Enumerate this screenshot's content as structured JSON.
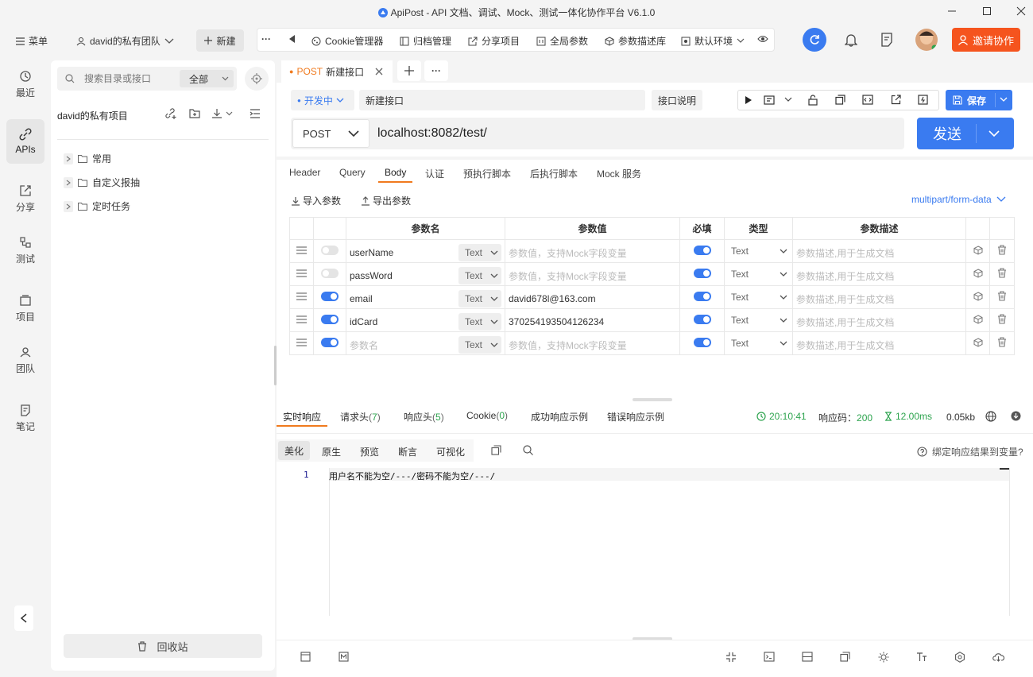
{
  "window": {
    "title": "ApiPost - API 文档、调试、Mock、测试一体化协作平台 V6.1.0"
  },
  "topbar": {
    "menu_label": "菜单",
    "team_label": "david的私有团队",
    "new_label": "新建",
    "cookie_label": "Cookie管理器",
    "archive_label": "归档管理",
    "share_label": "分享项目",
    "global_label": "全局参数",
    "desc_lib_label": "参数描述库",
    "env_label": "默认环境",
    "invite_label": "邀请协作"
  },
  "rail": {
    "items": [
      {
        "label": "最近",
        "icon": "history-icon"
      },
      {
        "label": "APIs",
        "icon": "api-link-icon"
      },
      {
        "label": "分享",
        "icon": "share-icon"
      },
      {
        "label": "测试",
        "icon": "test-flow-icon"
      },
      {
        "label": "项目",
        "icon": "project-icon"
      },
      {
        "label": "团队",
        "icon": "team-icon"
      },
      {
        "label": "笔记",
        "icon": "note-icon"
      }
    ]
  },
  "tree": {
    "search_placeholder": "搜索目录或接口",
    "filter_label": "全部",
    "project_title": "david的私有项目",
    "folders": [
      {
        "label": "常用"
      },
      {
        "label": "自定义报抽"
      },
      {
        "label": "定时任务"
      }
    ],
    "recycle_label": "回收站"
  },
  "tabs": {
    "active_method": "POST",
    "active_name": "新建接口"
  },
  "request": {
    "status_label": "开发中",
    "name_value": "新建接口",
    "doc_label": "接口说明",
    "save_label": "保存",
    "method": "POST",
    "url": "localhost:8082/test/",
    "send_label": "发送"
  },
  "subtabs": [
    "Header",
    "Query",
    "Body",
    "认证",
    "预执行脚本",
    "后执行脚本",
    "Mock 服务"
  ],
  "body": {
    "import_label": "导入参数",
    "export_label": "导出参数",
    "content_type": "multipart/form-data",
    "headers": {
      "name": "参数名",
      "value": "参数值",
      "required": "必填",
      "type": "类型",
      "desc": "参数描述"
    },
    "value_placeholder": "参数值，支持Mock字段变量",
    "desc_placeholder": "参数描述,用于生成文档",
    "name_placeholder": "参数名",
    "rows": [
      {
        "enabled": false,
        "name": "userName",
        "param_type": "Text",
        "value": "",
        "required": true,
        "type": "Text"
      },
      {
        "enabled": false,
        "name": "passWord",
        "param_type": "Text",
        "value": "",
        "required": true,
        "type": "Text"
      },
      {
        "enabled": true,
        "name": "email",
        "param_type": "Text",
        "value": "david678l@163.com",
        "required": true,
        "type": "Text"
      },
      {
        "enabled": true,
        "name": "idCard",
        "param_type": "Text",
        "value": "370254193504126234",
        "required": true,
        "type": "Text"
      },
      {
        "enabled": true,
        "name": "",
        "param_type": "Text",
        "value": "",
        "required": true,
        "type": "Text"
      }
    ]
  },
  "response": {
    "tabs": [
      {
        "label": "实时响应",
        "count": ""
      },
      {
        "label": "请求头",
        "count": "7"
      },
      {
        "label": "响应头",
        "count": "5"
      },
      {
        "label": "Cookie",
        "count": "0"
      },
      {
        "label": "成功响应示例",
        "count": ""
      },
      {
        "label": "错误响应示例",
        "count": ""
      }
    ],
    "time": "20:10:41",
    "code_label": "响应码：",
    "code": "200",
    "duration": "12.00ms",
    "size": "0.05kb",
    "view_tabs": [
      "美化",
      "原生",
      "预览",
      "断言",
      "可视化"
    ],
    "bind_label": "绑定响应结果到变量?",
    "line_number": "1",
    "body_text": "用户名不能为空/---/密码不能为空/---/"
  },
  "colors": {
    "accent": "#3a7bf0",
    "invite": "#f5541e",
    "method": "#f07a1e",
    "success": "#2ea44f"
  }
}
